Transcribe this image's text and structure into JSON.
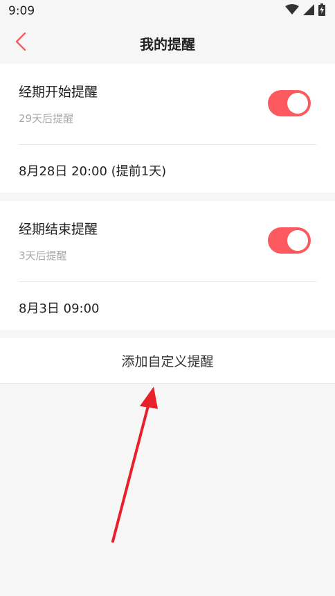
{
  "status_bar": {
    "time": "9:09",
    "icons": [
      "wifi-icon",
      "signal-icon",
      "battery-charging-icon"
    ]
  },
  "header": {
    "title": "我的提醒",
    "back_icon": "chevron-left-icon"
  },
  "reminders": [
    {
      "title": "经期开始提醒",
      "subtitle": "29天后提醒",
      "enabled": true,
      "time": "8月28日 20:00 (提前1天)"
    },
    {
      "title": "经期结束提醒",
      "subtitle": "3天后提醒",
      "enabled": true,
      "time": "8月3日 09:00"
    }
  ],
  "add_button": {
    "label": "添加自定义提醒"
  },
  "colors": {
    "accent": "#fc5a5f",
    "background": "#f6f6f6",
    "card": "#ffffff",
    "annotation": "#e8202a"
  }
}
